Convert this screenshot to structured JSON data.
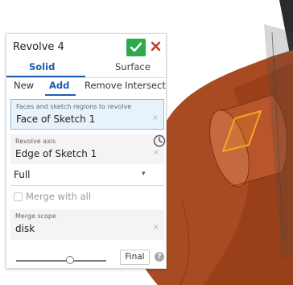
{
  "feature_dialog": {
    "title": "Revolve 4",
    "ok_icon": "check-icon",
    "cancel_icon": "close-icon",
    "body_types": [
      "Solid",
      "Surface"
    ],
    "selected_body_type": "Solid",
    "operations": [
      "New",
      "Add",
      "Remove",
      "Intersect"
    ],
    "selected_operation": "Add",
    "faces": {
      "label": "Faces and sketch regions to revolve",
      "value": "Face of Sketch 1",
      "clear_label": "×"
    },
    "axis": {
      "label": "Revolve axis",
      "value": "Edge of Sketch 1",
      "clear_label": "×",
      "icon": "clock-icon"
    },
    "extent": {
      "value": "Full",
      "caret": "▾"
    },
    "merge_with_all": {
      "label": "Merge with all",
      "checked": false
    },
    "merge_scope": {
      "label": "Merge scope",
      "value": "disk",
      "clear_label": "×"
    },
    "history_slider": {
      "position": 0.6
    },
    "final_button": "Final",
    "help_icon": "help-icon",
    "help_glyph": "?"
  },
  "colors": {
    "accent_blue": "#1e5eb0",
    "ok_green": "#2eaa4c",
    "cancel_red": "#c0392b",
    "part_orange": "#a84a22",
    "selection_highlight": "#f5a623"
  }
}
